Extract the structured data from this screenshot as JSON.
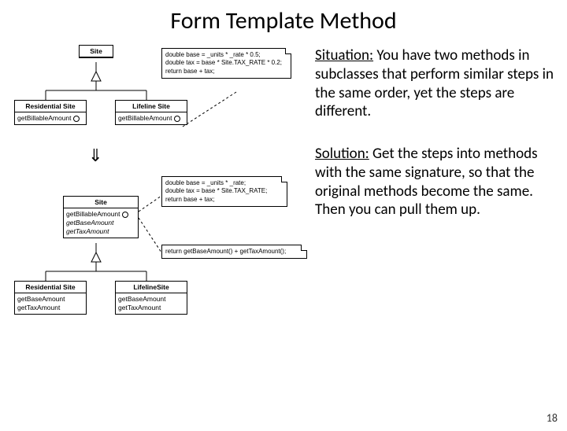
{
  "title": "Form Template Method",
  "situation_label": "Situation:",
  "situation_text": " You have two methods in subclasses that perform similar steps in the same order, yet the steps are different.",
  "solution_label": "Solution:",
  "solution_text": " Get the steps into methods with the same signature, so that the original methods become the same. Then you can pull them up.",
  "page_number": "18",
  "diagram": {
    "before": {
      "parent": "Site",
      "left": {
        "name": "Residential Site",
        "methods": [
          "getBillableAmount"
        ]
      },
      "right": {
        "name": "Lifeline Site",
        "methods": [
          "getBillableAmount"
        ]
      },
      "note_lines": [
        "double base = _units * _rate * 0.5;",
        "double tax = base * Site.TAX_RATE * 0.2;",
        "return base + tax;"
      ]
    },
    "arrow_glyph": "⇓",
    "after": {
      "parent": {
        "name": "Site",
        "methods": [
          "getBillableAmount",
          "getBaseAmount",
          "getTaxAmount"
        ]
      },
      "left": {
        "name": "Residential Site",
        "methods": [
          "getBaseAmount",
          "getTaxAmount"
        ]
      },
      "right": {
        "name": "LifelineSite",
        "methods": [
          "getBaseAmount",
          "getTaxAmount"
        ]
      },
      "note1_lines": [
        "double base = _units * _rate;",
        "double tax = base * Site.TAX_RATE;",
        "return base + tax;"
      ],
      "note2_lines": [
        "return getBaseAmount() + getTaxAmount();"
      ]
    }
  }
}
